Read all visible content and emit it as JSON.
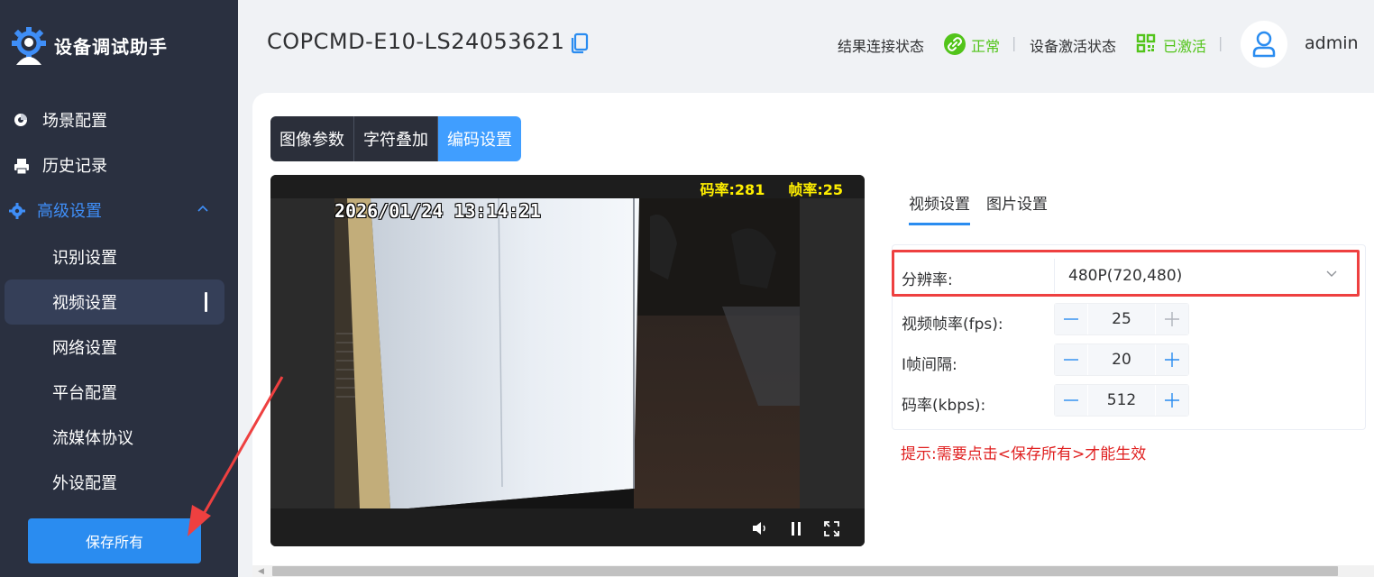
{
  "app": {
    "title": "设备调试助手"
  },
  "sidebar": {
    "menu": [
      {
        "label": "场景配置",
        "icon": "scene-icon"
      },
      {
        "label": "历史记录",
        "icon": "printer-icon"
      },
      {
        "label": "高级设置",
        "icon": "gear-icon",
        "expanded": true
      }
    ],
    "submenu": [
      {
        "label": "识别设置"
      },
      {
        "label": "视频设置",
        "active": true
      },
      {
        "label": "网络设置"
      },
      {
        "label": "平台配置"
      },
      {
        "label": "流媒体协议"
      },
      {
        "label": "外设配置"
      }
    ],
    "save_label": "保存所有"
  },
  "header": {
    "device_name": "COPCMD-E10-LS24053621",
    "result_conn_label": "结果连接状态",
    "result_conn_value": "正常",
    "activation_label": "设备激活状态",
    "activation_value": "已激活",
    "username": "admin"
  },
  "tabs": [
    {
      "label": "图像参数"
    },
    {
      "label": "字符叠加"
    },
    {
      "label": "编码设置",
      "active": true
    }
  ],
  "video": {
    "bitrate_label": "码率:",
    "bitrate_value": "281",
    "framerate_label": "帧率:",
    "framerate_value": "25",
    "timestamp": "2026/01/24 13:14:21"
  },
  "subtabs": [
    {
      "label": "视频设置",
      "active": true
    },
    {
      "label": "图片设置"
    }
  ],
  "form": {
    "resolution_label": "分辨率:",
    "resolution_value": "480P(720,480)",
    "fps_label": "视频帧率(fps):",
    "fps_value": "25",
    "iframe_label": "I帧间隔:",
    "iframe_value": "20",
    "bitrate_label": "码率(kbps):",
    "bitrate_value": "512"
  },
  "tip": "提示:需要点击<保存所有>才能生效",
  "colors": {
    "sidebar_bg": "#2a3040",
    "accent": "#2a8cf0",
    "success": "#52c41a",
    "warning_text": "#e02020",
    "highlight_frame": "#ee4040",
    "overlay_text": "#ffef00"
  }
}
